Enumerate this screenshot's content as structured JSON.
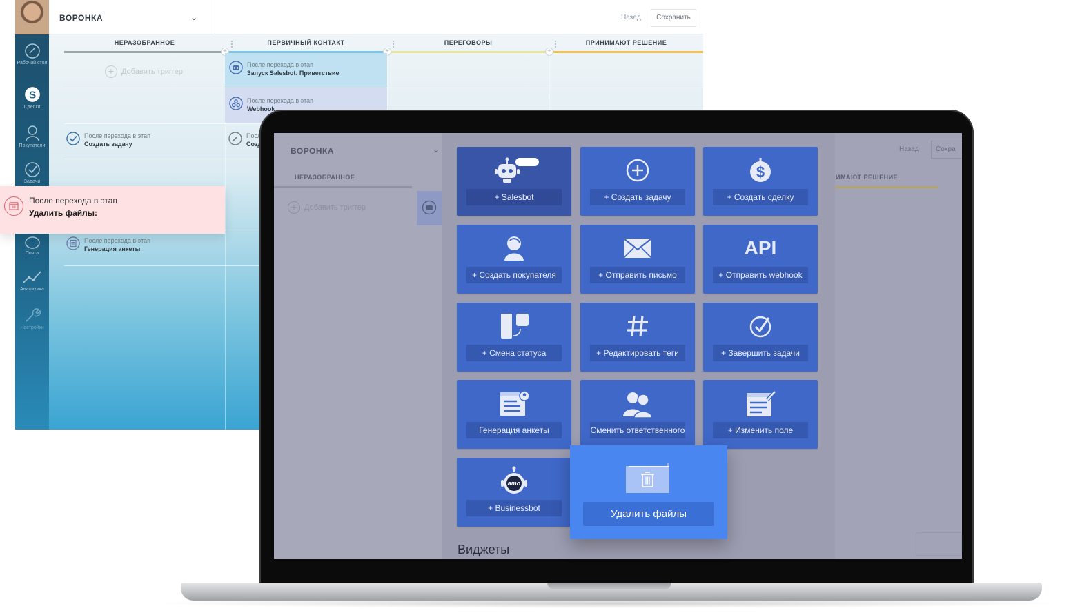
{
  "back_window": {
    "pipeline_title": "ВОРОНКА",
    "back_label": "Назад",
    "save_label": "Сохранить",
    "sidebar": [
      {
        "label": "Рабочий стол",
        "icon": "dashboard-icon"
      },
      {
        "label": "Сделки",
        "icon": "deals-icon"
      },
      {
        "label": "Покупатели",
        "icon": "customers-icon"
      },
      {
        "label": "Задачи",
        "icon": "tasks-icon"
      },
      {
        "label": "Почта",
        "icon": "mail-icon"
      },
      {
        "label": "Аналитика",
        "icon": "analytics-icon"
      },
      {
        "label": "Настройки",
        "icon": "settings-icon"
      }
    ],
    "columns": [
      {
        "label": "НЕРАЗОБРАННОЕ",
        "color": "#9aa3a8"
      },
      {
        "label": "ПЕРВИЧНЫЙ КОНТАКТ",
        "color": "#7cc3ec"
      },
      {
        "label": "ПЕРЕГОВОРЫ",
        "color": "#e8e59a"
      },
      {
        "label": "ПРИНИМАЮТ РЕШЕНИЕ",
        "color": "#f2c14d"
      }
    ],
    "add_trigger": "Добавить триггер",
    "triggers": [
      {
        "caption": "После перехода в этап",
        "action": "Запуск Salesbot: Приветствие"
      },
      {
        "caption": "После перехода в этап",
        "action": "Webhook"
      },
      {
        "caption": "После перехода в этап",
        "action": "Создать задачу"
      },
      {
        "caption": "После",
        "action": "Созд"
      },
      {
        "caption": "После перехода в этап",
        "action": "Генерация анкеты"
      }
    ]
  },
  "popup": {
    "caption": "После перехода в этап",
    "action": "Удалить файлы:",
    "icon": "folder-delete-icon",
    "accent": "#e0636e"
  },
  "screen": {
    "pipeline_title": "ВОРОНКА",
    "back_label": "Назад",
    "save_label": "Сохра",
    "column_left": "НЕРАЗОБРАННОЕ",
    "column_right": "ИМАЮТ РЕШЕНИЕ",
    "add_trigger": "Добавить триггер",
    "cards": [
      {
        "label": "+ Salesbot",
        "icon": "salesbot-icon"
      },
      {
        "label": "+ Создать задачу",
        "icon": "plus-circle-icon"
      },
      {
        "label": "+ Создать сделку",
        "icon": "dollar-icon"
      },
      {
        "label": "+ Создать покупателя",
        "icon": "customer-icon"
      },
      {
        "label": "+ Отправить письмо",
        "icon": "envelope-icon"
      },
      {
        "label": "+ Отправить webhook",
        "icon": "api-icon",
        "icon_text": "API"
      },
      {
        "label": "+ Смена статуса",
        "icon": "status-change-icon"
      },
      {
        "label": "+ Редактировать теги",
        "icon": "hashtag-icon"
      },
      {
        "label": "+ Завершить задачи",
        "icon": "check-circle-icon"
      },
      {
        "label": "Генерация анкеты",
        "icon": "form-icon"
      },
      {
        "label": "Сменить ответственного",
        "icon": "users-icon"
      },
      {
        "label": "+ Изменить поле",
        "icon": "edit-field-icon"
      },
      {
        "label": "+ Businessbot",
        "icon": "businessbot-icon",
        "icon_text": "amo"
      }
    ],
    "delete_files": {
      "label": "Удалить файлы",
      "icon": "folder-trash-icon"
    },
    "widgets_title": "Виджеты"
  }
}
